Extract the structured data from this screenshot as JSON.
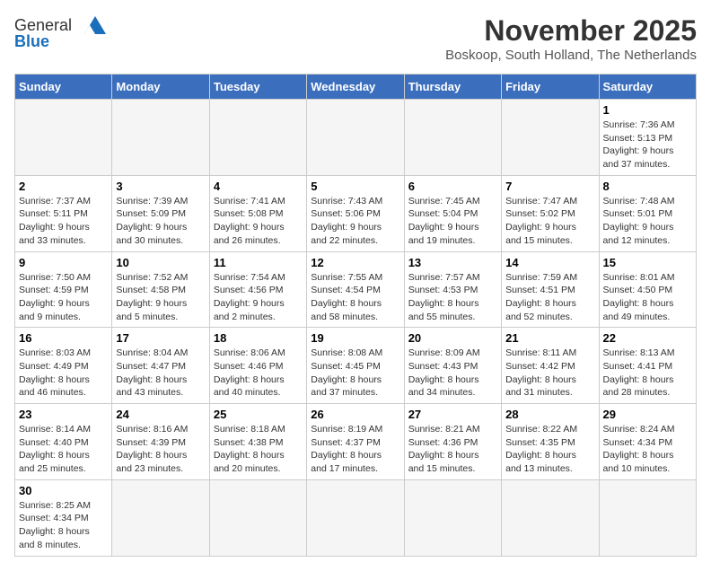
{
  "header": {
    "logo_general": "General",
    "logo_blue": "Blue",
    "month_title": "November 2025",
    "location": "Boskoop, South Holland, The Netherlands"
  },
  "weekdays": [
    "Sunday",
    "Monday",
    "Tuesday",
    "Wednesday",
    "Thursday",
    "Friday",
    "Saturday"
  ],
  "weeks": [
    [
      {
        "day": "",
        "info": ""
      },
      {
        "day": "",
        "info": ""
      },
      {
        "day": "",
        "info": ""
      },
      {
        "day": "",
        "info": ""
      },
      {
        "day": "",
        "info": ""
      },
      {
        "day": "",
        "info": ""
      },
      {
        "day": "1",
        "info": "Sunrise: 7:36 AM\nSunset: 5:13 PM\nDaylight: 9 hours\nand 37 minutes."
      }
    ],
    [
      {
        "day": "2",
        "info": "Sunrise: 7:37 AM\nSunset: 5:11 PM\nDaylight: 9 hours\nand 33 minutes."
      },
      {
        "day": "3",
        "info": "Sunrise: 7:39 AM\nSunset: 5:09 PM\nDaylight: 9 hours\nand 30 minutes."
      },
      {
        "day": "4",
        "info": "Sunrise: 7:41 AM\nSunset: 5:08 PM\nDaylight: 9 hours\nand 26 minutes."
      },
      {
        "day": "5",
        "info": "Sunrise: 7:43 AM\nSunset: 5:06 PM\nDaylight: 9 hours\nand 22 minutes."
      },
      {
        "day": "6",
        "info": "Sunrise: 7:45 AM\nSunset: 5:04 PM\nDaylight: 9 hours\nand 19 minutes."
      },
      {
        "day": "7",
        "info": "Sunrise: 7:47 AM\nSunset: 5:02 PM\nDaylight: 9 hours\nand 15 minutes."
      },
      {
        "day": "8",
        "info": "Sunrise: 7:48 AM\nSunset: 5:01 PM\nDaylight: 9 hours\nand 12 minutes."
      }
    ],
    [
      {
        "day": "9",
        "info": "Sunrise: 7:50 AM\nSunset: 4:59 PM\nDaylight: 9 hours\nand 9 minutes."
      },
      {
        "day": "10",
        "info": "Sunrise: 7:52 AM\nSunset: 4:58 PM\nDaylight: 9 hours\nand 5 minutes."
      },
      {
        "day": "11",
        "info": "Sunrise: 7:54 AM\nSunset: 4:56 PM\nDaylight: 9 hours\nand 2 minutes."
      },
      {
        "day": "12",
        "info": "Sunrise: 7:55 AM\nSunset: 4:54 PM\nDaylight: 8 hours\nand 58 minutes."
      },
      {
        "day": "13",
        "info": "Sunrise: 7:57 AM\nSunset: 4:53 PM\nDaylight: 8 hours\nand 55 minutes."
      },
      {
        "day": "14",
        "info": "Sunrise: 7:59 AM\nSunset: 4:51 PM\nDaylight: 8 hours\nand 52 minutes."
      },
      {
        "day": "15",
        "info": "Sunrise: 8:01 AM\nSunset: 4:50 PM\nDaylight: 8 hours\nand 49 minutes."
      }
    ],
    [
      {
        "day": "16",
        "info": "Sunrise: 8:03 AM\nSunset: 4:49 PM\nDaylight: 8 hours\nand 46 minutes."
      },
      {
        "day": "17",
        "info": "Sunrise: 8:04 AM\nSunset: 4:47 PM\nDaylight: 8 hours\nand 43 minutes."
      },
      {
        "day": "18",
        "info": "Sunrise: 8:06 AM\nSunset: 4:46 PM\nDaylight: 8 hours\nand 40 minutes."
      },
      {
        "day": "19",
        "info": "Sunrise: 8:08 AM\nSunset: 4:45 PM\nDaylight: 8 hours\nand 37 minutes."
      },
      {
        "day": "20",
        "info": "Sunrise: 8:09 AM\nSunset: 4:43 PM\nDaylight: 8 hours\nand 34 minutes."
      },
      {
        "day": "21",
        "info": "Sunrise: 8:11 AM\nSunset: 4:42 PM\nDaylight: 8 hours\nand 31 minutes."
      },
      {
        "day": "22",
        "info": "Sunrise: 8:13 AM\nSunset: 4:41 PM\nDaylight: 8 hours\nand 28 minutes."
      }
    ],
    [
      {
        "day": "23",
        "info": "Sunrise: 8:14 AM\nSunset: 4:40 PM\nDaylight: 8 hours\nand 25 minutes."
      },
      {
        "day": "24",
        "info": "Sunrise: 8:16 AM\nSunset: 4:39 PM\nDaylight: 8 hours\nand 23 minutes."
      },
      {
        "day": "25",
        "info": "Sunrise: 8:18 AM\nSunset: 4:38 PM\nDaylight: 8 hours\nand 20 minutes."
      },
      {
        "day": "26",
        "info": "Sunrise: 8:19 AM\nSunset: 4:37 PM\nDaylight: 8 hours\nand 17 minutes."
      },
      {
        "day": "27",
        "info": "Sunrise: 8:21 AM\nSunset: 4:36 PM\nDaylight: 8 hours\nand 15 minutes."
      },
      {
        "day": "28",
        "info": "Sunrise: 8:22 AM\nSunset: 4:35 PM\nDaylight: 8 hours\nand 13 minutes."
      },
      {
        "day": "29",
        "info": "Sunrise: 8:24 AM\nSunset: 4:34 PM\nDaylight: 8 hours\nand 10 minutes."
      }
    ],
    [
      {
        "day": "30",
        "info": "Sunrise: 8:25 AM\nSunset: 4:34 PM\nDaylight: 8 hours\nand 8 minutes."
      },
      {
        "day": "",
        "info": ""
      },
      {
        "day": "",
        "info": ""
      },
      {
        "day": "",
        "info": ""
      },
      {
        "day": "",
        "info": ""
      },
      {
        "day": "",
        "info": ""
      },
      {
        "day": "",
        "info": ""
      }
    ]
  ]
}
